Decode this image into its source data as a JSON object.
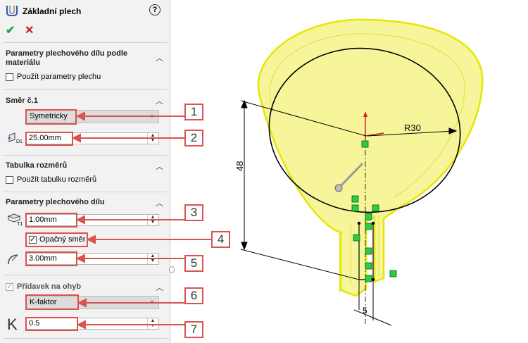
{
  "panel": {
    "title": "Základní plech",
    "help_icon": "?",
    "ok_icon": "✔",
    "cancel_icon": "✕"
  },
  "sections": {
    "material": {
      "title": "Parametry plechového dílu podle materiálu",
      "checkbox_label": "Použít parametry plechu",
      "checked": false
    },
    "direction": {
      "title": "Směr č.1",
      "type_value": "Symetricky",
      "depth_value": "25.00mm",
      "depth_icon_label": "D1"
    },
    "table": {
      "title": "Tabulka rozměrů",
      "checkbox_label": "Použít tabulku rozměrů",
      "checked": false
    },
    "sheet": {
      "title": "Parametry plechového dílu",
      "thickness_value": "1.00mm",
      "thickness_icon_label": "T1",
      "reverse_label": "Opačný směr",
      "reverse_checked": true,
      "radius_value": "3.00mm"
    },
    "bend": {
      "title": "Přídavek na ohyb",
      "checked": true,
      "type_value": "K-faktor",
      "k_value": "0.5",
      "k_icon": "K"
    }
  },
  "callouts": [
    "1",
    "2",
    "3",
    "4",
    "5",
    "6",
    "7"
  ],
  "drawing": {
    "dim_radius": "R30",
    "dim_height": "48",
    "dim_width": "5",
    "accent_color": "#d9534f",
    "part_color": "#f7f59a",
    "edge_color": "#e6e600",
    "sketch_color": "#000000"
  }
}
